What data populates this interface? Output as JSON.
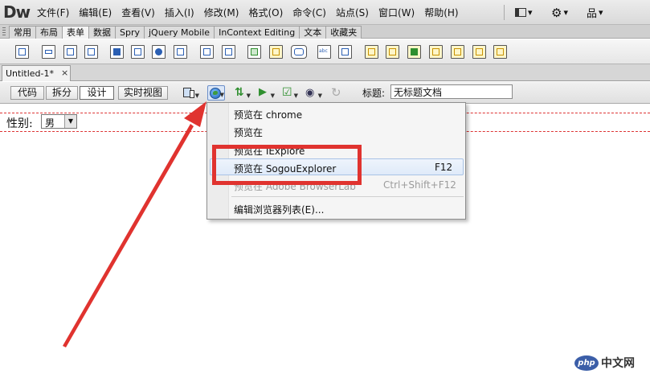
{
  "app": {
    "logo": "Dw"
  },
  "menubar": {
    "items": [
      "文件(F)",
      "编辑(E)",
      "查看(V)",
      "插入(I)",
      "修改(M)",
      "格式(O)",
      "命令(C)",
      "站点(S)",
      "窗口(W)",
      "帮助(H)"
    ],
    "right": [
      {
        "icon": "layout-icon",
        "arrow": "▾"
      },
      {
        "icon": "gear-icon",
        "glyph": "⚙",
        "arrow": "▾"
      },
      {
        "icon": "site-icon",
        "glyph": "品",
        "arrow": "▾"
      }
    ]
  },
  "insert_panel": {
    "tabs": [
      "常用",
      "布局",
      "表单",
      "数据",
      "Spry",
      "jQuery Mobile",
      "InContext Editing",
      "文本",
      "收藏夹"
    ],
    "active_tab": "表单"
  },
  "document": {
    "tab_name": "Untitled-1*",
    "close_glyph": "×"
  },
  "doc_toolbar": {
    "views": [
      "代码",
      "拆分",
      "设计",
      "实时视图"
    ],
    "active_view": "设计",
    "title_label": "标题:",
    "title_value": "无标题文档"
  },
  "canvas": {
    "field_label": "性别:",
    "select_value": "男",
    "select_arrow": "▼"
  },
  "preview_menu": {
    "items": [
      {
        "label": "预览在 chrome",
        "shortcut": "",
        "dim": false
      },
      {
        "label": "预览在",
        "shortcut": "",
        "dim": false
      },
      {
        "label": "预览在 IExplore",
        "shortcut": "",
        "dim": false
      },
      {
        "label": "预览在 SogouExplorer",
        "shortcut": "F12",
        "dim": false,
        "highlighted": true
      },
      {
        "label": "预览在 Adobe BrowserLab",
        "shortcut": "Ctrl+Shift+F12",
        "dim": true
      },
      {
        "label": "编辑浏览器列表(E)...",
        "shortcut": "",
        "dim": false
      }
    ]
  },
  "annotation": {
    "color": "#e0332f"
  },
  "watermark": {
    "badge": "php",
    "text": "中文网"
  }
}
